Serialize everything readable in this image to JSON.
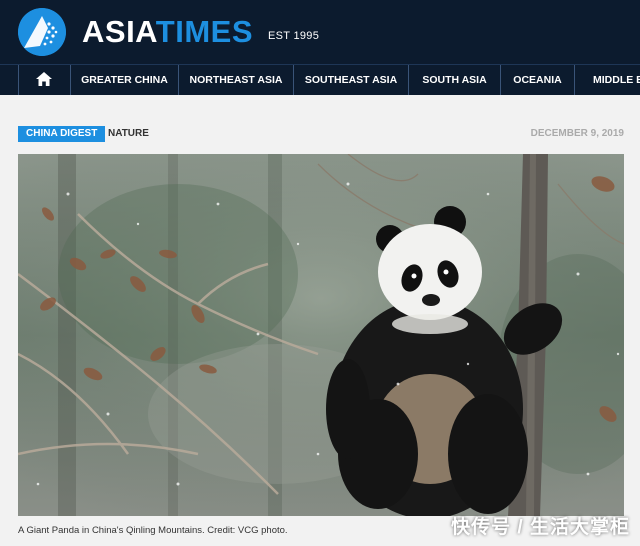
{
  "header": {
    "logo_part1": "ASIA",
    "logo_part2": "TIMES",
    "est": "EST 1995"
  },
  "nav": {
    "home_icon": "home-icon",
    "items": [
      {
        "label": "GREATER CHINA"
      },
      {
        "label": "NORTHEAST ASIA"
      },
      {
        "label": "SOUTHEAST ASIA"
      },
      {
        "label": "SOUTH ASIA"
      },
      {
        "label": "OCEANIA"
      },
      {
        "label": "MIDDLE EA"
      }
    ]
  },
  "article": {
    "category": "CHINA DIGEST",
    "subcategory": "NATURE",
    "date": "DECEMBER 9, 2019",
    "image_subject": "giant-panda-in-tree",
    "caption": "A Giant Panda in China's Qinling Mountains. Credit: VCG photo."
  },
  "watermark": "快传号 / 生活大掌柜",
  "colors": {
    "header_bg": "#0c1b2e",
    "accent_blue": "#1d8fe0",
    "page_bg": "#f2f2f2"
  }
}
